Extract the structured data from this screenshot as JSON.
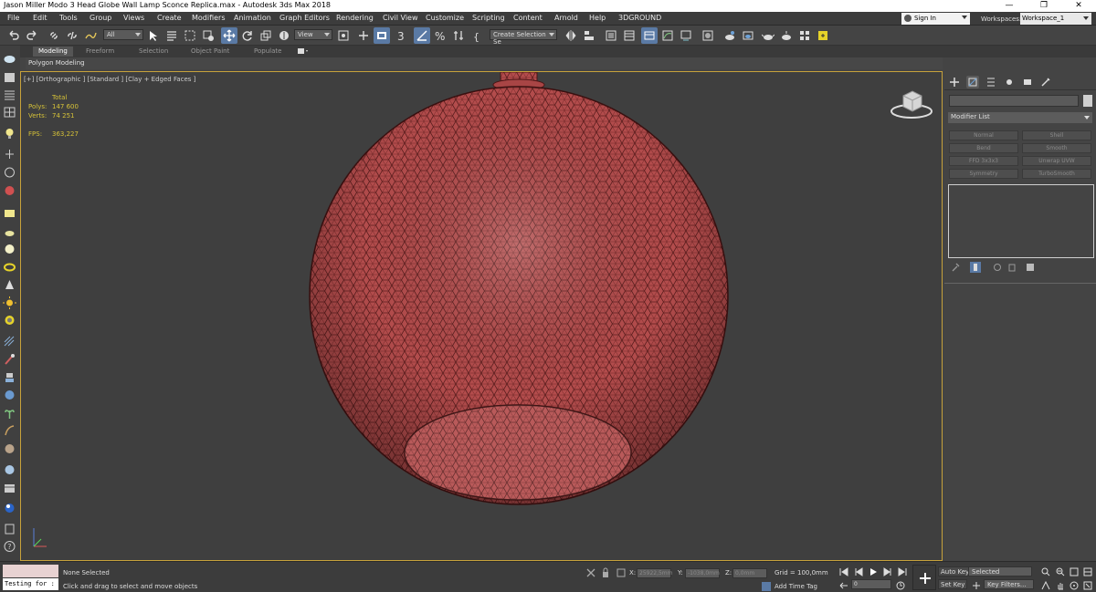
{
  "window": {
    "title": "Jason Miller Modo 3 Head Globe Wall Lamp Sconce Replica.max - Autodesk 3ds Max 2018",
    "minimize": "—",
    "restore": "❐",
    "close": "✕"
  },
  "menu": [
    "File",
    "Edit",
    "Tools",
    "Group",
    "Views",
    "Create",
    "Modifiers",
    "Animation",
    "Graph Editors",
    "Rendering",
    "Civil View",
    "Customize",
    "Scripting",
    "Content",
    "Arnold",
    "Help",
    "3DGROUND"
  ],
  "account": {
    "signin": "Sign In",
    "workspaces_label": "Workspaces:",
    "workspace": "Workspace_1"
  },
  "toolbar": {
    "selection_filter": "All",
    "ref_coord": "View",
    "named_selection": "Create Selection Se",
    "snap_label": "3"
  },
  "ribbon": {
    "tabs": [
      "Modeling",
      "Freeform",
      "Selection",
      "Object Paint",
      "Populate"
    ],
    "active": "Modeling",
    "subpanel": "Polygon Modeling"
  },
  "viewport": {
    "label": "[+] [Orthographic ] [Standard ] [Clay + Edged Faces ]",
    "stats_header": "Total",
    "polys_label": "Polys:",
    "polys_value": "147 600",
    "verts_label": "Verts:",
    "verts_value": "74 251",
    "fps_label": "FPS:",
    "fps_value": "363,227",
    "colors": {
      "model": "#b24a4a",
      "wire": "#5a1d1d",
      "bg": "#3f3f3f"
    }
  },
  "command_panel": {
    "modifier_list": "Modifier List",
    "buttons": [
      "Normal",
      "Shell",
      "Bend",
      "Smooth",
      "FFD 3x3x3",
      "Unwrap UVW",
      "Symmetry",
      "TurboSmooth"
    ]
  },
  "status": {
    "selection": "None Selected",
    "prompt": "Click and drag to select and move objects",
    "maxscript": "Testing for :",
    "x_label": "X:",
    "x_value": "25922,5mm",
    "y_label": "Y:",
    "y_value": "-1038,0mm",
    "z_label": "Z:",
    "z_value": "0,0mm",
    "grid": "Grid = 100,0mm",
    "add_time_tag": "Add Time Tag",
    "frame": "0",
    "auto_key": "Auto Key",
    "set_key": "Set Key",
    "selected": "Selected",
    "key_filters": "Key Filters..."
  }
}
